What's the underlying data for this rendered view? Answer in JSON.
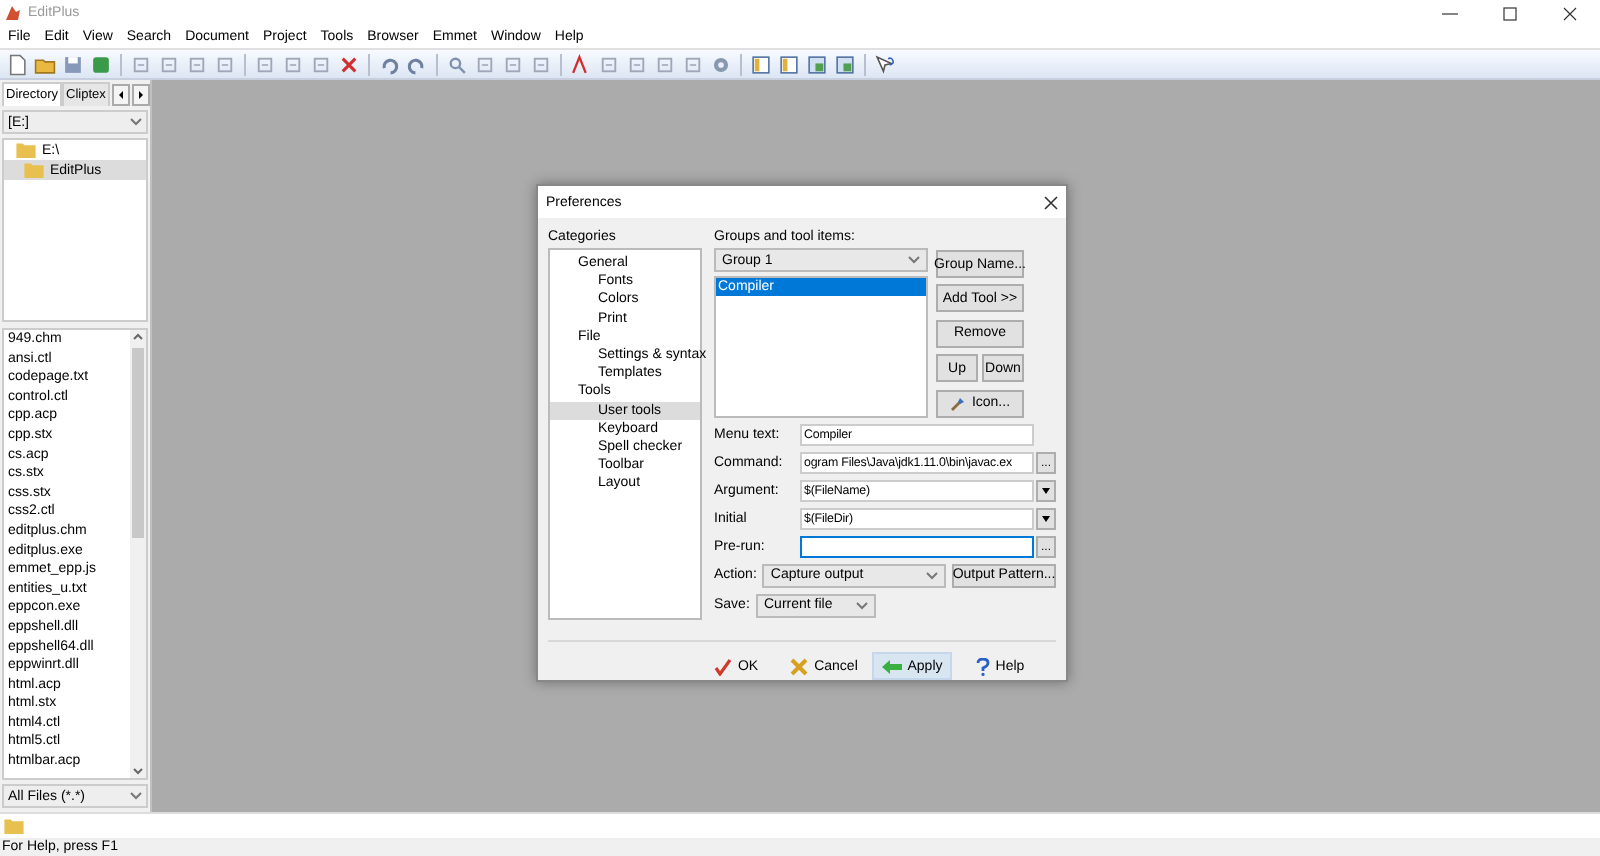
{
  "app": {
    "title": "EditPlus"
  },
  "menu": [
    "File",
    "Edit",
    "View",
    "Search",
    "Document",
    "Project",
    "Tools",
    "Browser",
    "Emmet",
    "Window",
    "Help"
  ],
  "left_panel": {
    "tabs": [
      {
        "label": "Directory",
        "selected": true
      },
      {
        "label": "Cliptex",
        "selected": false
      }
    ],
    "drive": "[E:]",
    "folders": [
      {
        "label": "E:\\",
        "selected": false,
        "children": [
          {
            "label": "EditPlus",
            "selected": true
          }
        ]
      }
    ],
    "files": [
      "949.chm",
      "ansi.ctl",
      "codepage.txt",
      "control.ctl",
      "cpp.acp",
      "cpp.stx",
      "cs.acp",
      "cs.stx",
      "css.stx",
      "css2.ctl",
      "editplus.chm",
      "editplus.exe",
      "emmet_epp.js",
      "entities_u.txt",
      "eppcon.exe",
      "eppshell.dll",
      "eppshell64.dll",
      "eppwinrt.dll",
      "html.acp",
      "html.stx",
      "html4.ctl",
      "html5.ctl",
      "htmlbar.acp"
    ],
    "filter": "All Files (*.*)"
  },
  "dialog": {
    "title": "Preferences",
    "categories_label": "Categories",
    "categories": [
      {
        "label": "General",
        "selected": false,
        "children": [
          {
            "label": "Fonts",
            "selected": false
          },
          {
            "label": "Colors",
            "selected": false
          },
          {
            "label": "Print",
            "selected": false
          }
        ]
      },
      {
        "label": "File",
        "selected": false,
        "children": [
          {
            "label": "Settings & syntax",
            "selected": false
          },
          {
            "label": "Templates",
            "selected": false
          }
        ]
      },
      {
        "label": "Tools",
        "selected": false,
        "children": [
          {
            "label": "User tools",
            "selected": true
          },
          {
            "label": "Keyboard",
            "selected": false
          },
          {
            "label": "Spell checker",
            "selected": false
          },
          {
            "label": "Toolbar",
            "selected": false
          },
          {
            "label": "Layout",
            "selected": false
          }
        ]
      }
    ],
    "groups_label": "Groups and tool items:",
    "group": "Group 1",
    "tools": [
      {
        "label": "Compiler",
        "selected": true
      }
    ],
    "side_buttons": [
      {
        "label": "Group Name...",
        "kind": "wide"
      },
      {
        "label": "Add Tool >>",
        "kind": "wide"
      },
      {
        "label": "Remove",
        "kind": "wide"
      },
      {
        "label": "Up",
        "kind": "half"
      },
      {
        "label": "Down",
        "kind": "half"
      },
      {
        "label": "Icon...",
        "kind": "icon"
      }
    ],
    "fields": [
      {
        "label": "Menu text:",
        "value": "Compiler",
        "kind": "text",
        "focused": false
      },
      {
        "label": "Command:",
        "value": "ogram Files\\Java\\jdk1.11.0\\bin\\javac.ex",
        "kind": "browse",
        "button": "...",
        "focused": false
      },
      {
        "label": "Argument:",
        "value": "$(FileName)",
        "kind": "menu",
        "focused": false
      },
      {
        "label": "Initial",
        "value": "$(FileDir)",
        "kind": "menu",
        "focused": false
      },
      {
        "label": "Pre-run:",
        "kind": "browse",
        "button": "...",
        "focused": true
      }
    ],
    "action": {
      "label": "Action:",
      "value": "Capture output",
      "button": "Output Pattern..."
    },
    "save": {
      "label": "Save:",
      "value": "Current file"
    },
    "footer_buttons": [
      {
        "label": "OK",
        "kind": "ok",
        "hovered": false
      },
      {
        "label": "Cancel",
        "kind": "cancel",
        "hovered": false
      },
      {
        "label": "Apply",
        "kind": "apply",
        "hovered": true
      },
      {
        "label": "Help",
        "kind": "help",
        "hovered": false
      }
    ]
  },
  "status_bar": "For Help, press F1"
}
